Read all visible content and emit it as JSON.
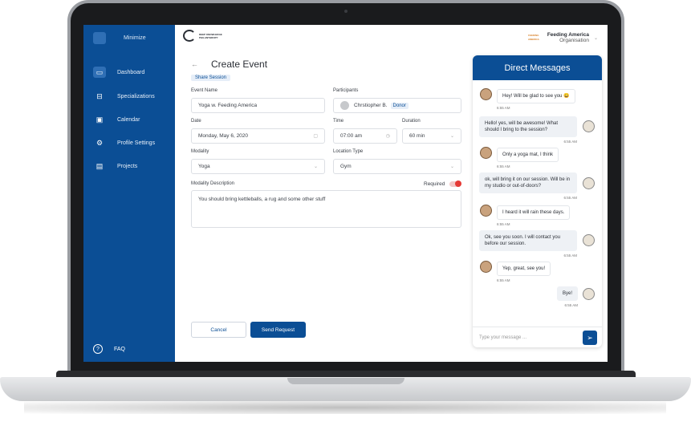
{
  "sidebar": {
    "minimize_label": "Minimize",
    "items": [
      {
        "label": "Dashboard",
        "icon": "dashboard-icon",
        "active": true
      },
      {
        "label": "Specializations",
        "icon": "briefcase-icon",
        "active": false
      },
      {
        "label": "Calendar",
        "icon": "calendar-icon",
        "active": false
      },
      {
        "label": "Profile Settings",
        "icon": "gear-icon",
        "active": false
      },
      {
        "label": "Projects",
        "icon": "folder-icon",
        "active": false
      }
    ],
    "faq_label": "FAQ"
  },
  "header": {
    "logo_text": "DEEP KNOWLEDGE PHILANTHROPY",
    "org_logo_text": "FEEDING AMERICA",
    "org_name": "Feeding America",
    "org_role": "Organisation"
  },
  "form": {
    "title": "Create Event",
    "share_label": "Share Session",
    "event_name_label": "Event Name",
    "event_name_value": "Yoga w. Feeding America",
    "participants_label": "Participants",
    "participant_name": "Chrstiopher B.",
    "participant_tag": "Donor",
    "date_label": "Date",
    "date_value": "Monday, May 6, 2020",
    "time_label": "Time",
    "time_value": "07:00 am",
    "duration_label": "Duration",
    "duration_value": "60 min",
    "modality_label": "Modality",
    "modality_value": "Yoga",
    "location_label": "Location Type",
    "location_value": "Gym",
    "desc_label": "Modality Description",
    "required_label": "Required",
    "desc_value": "You should bring kettleballs, a rug and some other stuff",
    "cancel_label": "Cancel",
    "send_label": "Send Request"
  },
  "messages": {
    "title": "Direct Messages",
    "input_placeholder": "Type your message ...",
    "items": [
      {
        "text": "Hey! Will be glad to see you 😀",
        "time": "6:55 AM",
        "dir": "in"
      },
      {
        "text": "Hello! yes, will be awesome! What should I bring to the session?",
        "time": "6:55 AM",
        "dir": "out"
      },
      {
        "text": "Only a yoga mat, I think",
        "time": "6:55 AM",
        "dir": "in"
      },
      {
        "text": "ok, will bring it on our session. Will be in my studio or out-of-doors?",
        "time": "6:55 AM",
        "dir": "out"
      },
      {
        "text": "I heard it will rain these days.",
        "time": "6:55 AM",
        "dir": "in"
      },
      {
        "text": "Ok, see you soon. I will contact you before our session.",
        "time": "6:55 AM",
        "dir": "out"
      },
      {
        "text": "Yep, great, see you!",
        "time": "6:55 AM",
        "dir": "in"
      },
      {
        "text": "Bye!",
        "time": "6:55 AM",
        "dir": "out"
      }
    ]
  }
}
